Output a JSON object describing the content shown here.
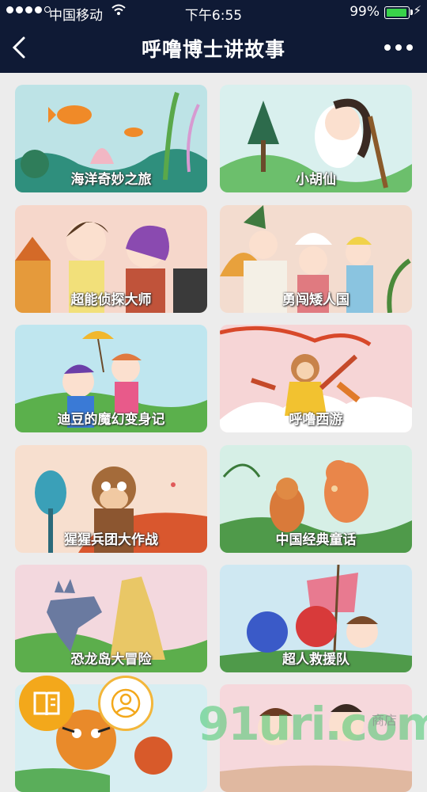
{
  "status_bar": {
    "carrier": "中国移动",
    "time": "下午6:55",
    "battery": "99%"
  },
  "nav": {
    "title": "呼噜博士讲故事",
    "back_icon": "chevron-left-icon",
    "more_icon": "more-dots-icon"
  },
  "stories": [
    {
      "label": "海洋奇妙之旅",
      "bg": "#bde3e6"
    },
    {
      "label": "小胡仙",
      "bg": "#d9f0ee"
    },
    {
      "label": "超能侦探大师",
      "bg": "#f6d7cb"
    },
    {
      "label": "勇闯矮人国",
      "bg": "#f3dccf"
    },
    {
      "label": "迪豆的魔幻变身记",
      "bg": "#bfe6ef"
    },
    {
      "label": "呼噜西游",
      "bg": "#f6d5d6"
    },
    {
      "label": "猩猩兵团大作战",
      "bg": "#f7dfcf"
    },
    {
      "label": "中国经典童话",
      "bg": "#d6efe6"
    },
    {
      "label": "恐龙岛大冒险",
      "bg": "#f3d8de"
    },
    {
      "label": "超人救援队",
      "bg": "#cfe8f2"
    },
    {
      "label": "",
      "bg": "#d7eef2"
    },
    {
      "label": "",
      "bg": "#f6d8dc"
    }
  ],
  "fabs": {
    "book_icon": "book-icon",
    "user_icon": "user-icon"
  },
  "watermark": {
    "text": "91uri.com",
    "small": "商店"
  }
}
